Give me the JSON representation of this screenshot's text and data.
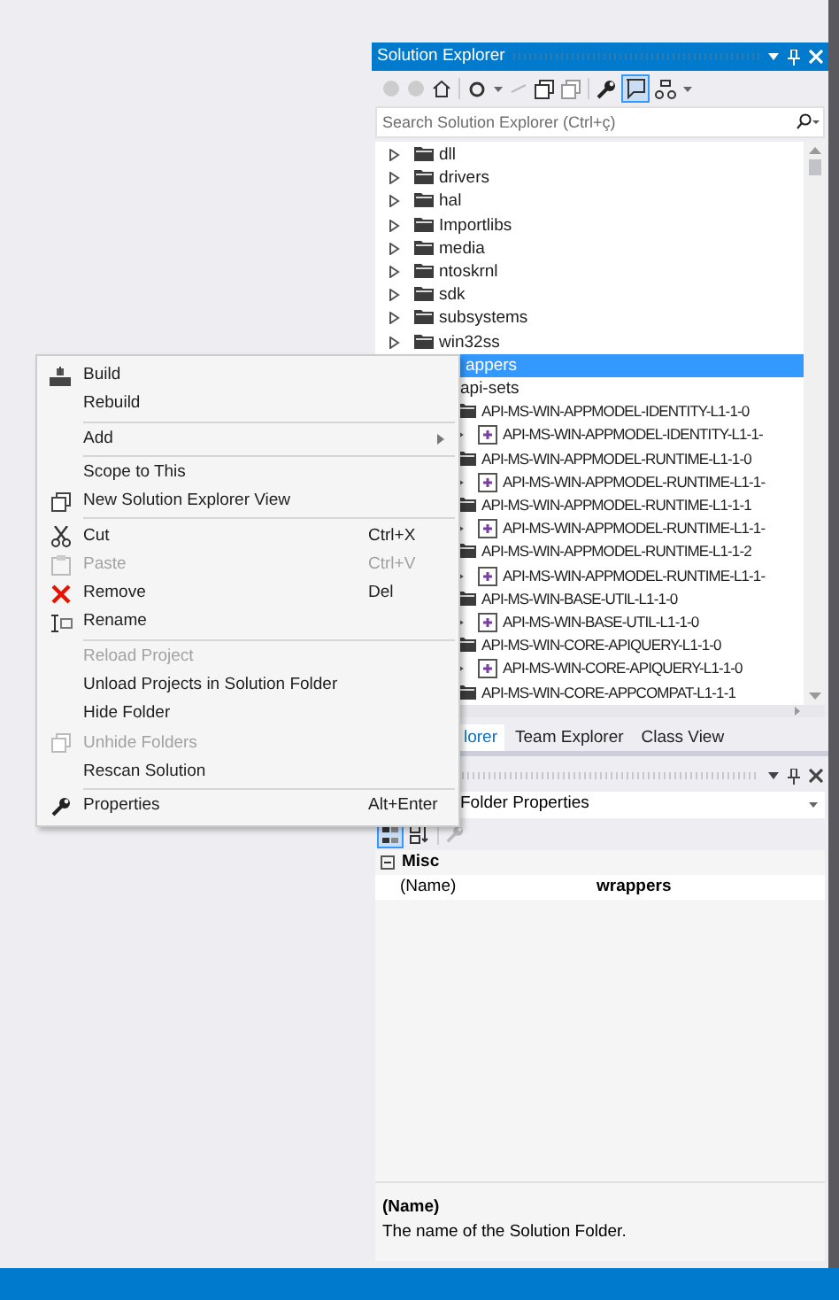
{
  "solution_explorer": {
    "title": "Solution Explorer",
    "search": {
      "placeholder": "Search Solution Explorer (Ctrl+ç)"
    },
    "tree": [
      {
        "label": "dll",
        "kind": "folder",
        "expanded": false,
        "selected": false
      },
      {
        "label": "drivers",
        "kind": "folder",
        "expanded": false,
        "selected": false
      },
      {
        "label": "hal",
        "kind": "folder",
        "expanded": false,
        "selected": false
      },
      {
        "label": "Importlibs",
        "kind": "folder",
        "expanded": false,
        "selected": false
      },
      {
        "label": "media",
        "kind": "folder",
        "expanded": false,
        "selected": false
      },
      {
        "label": "ntoskrnl",
        "kind": "folder",
        "expanded": false,
        "selected": false
      },
      {
        "label": "sdk",
        "kind": "folder",
        "expanded": false,
        "selected": false
      },
      {
        "label": "subsystems",
        "kind": "folder",
        "expanded": false,
        "selected": false
      },
      {
        "label": "win32ss",
        "kind": "folder",
        "expanded": false,
        "selected": false
      },
      {
        "label": "appers",
        "selected": true,
        "children": [
          {
            "label": "api-sets",
            "selected": false,
            "children": [
              {
                "label": "API-MS-WIN-APPMODEL-IDENTITY-L1-1-0",
                "kind": "folder",
                "selected": false,
                "children": [
                  {
                    "label": "API-MS-WIN-APPMODEL-IDENTITY-L1-1-",
                    "kind": "project",
                    "expanded": false,
                    "selected": false
                  }
                ]
              },
              {
                "label": "API-MS-WIN-APPMODEL-RUNTIME-L1-1-0",
                "kind": "folder",
                "selected": false,
                "children": [
                  {
                    "label": "API-MS-WIN-APPMODEL-RUNTIME-L1-1-",
                    "kind": "project",
                    "expanded": false,
                    "selected": false
                  }
                ]
              },
              {
                "label": "API-MS-WIN-APPMODEL-RUNTIME-L1-1-1",
                "kind": "folder",
                "selected": false,
                "children": [
                  {
                    "label": "API-MS-WIN-APPMODEL-RUNTIME-L1-1-",
                    "kind": "project",
                    "expanded": false,
                    "selected": false
                  }
                ]
              },
              {
                "label": "API-MS-WIN-APPMODEL-RUNTIME-L1-1-2",
                "kind": "folder",
                "selected": false,
                "children": [
                  {
                    "label": "API-MS-WIN-APPMODEL-RUNTIME-L1-1-",
                    "kind": "project",
                    "expanded": false,
                    "selected": false
                  }
                ]
              },
              {
                "label": "API-MS-WIN-BASE-UTIL-L1-1-0",
                "kind": "folder",
                "selected": false,
                "children": [
                  {
                    "label": "API-MS-WIN-BASE-UTIL-L1-1-0",
                    "kind": "project",
                    "expanded": false,
                    "selected": false
                  }
                ]
              },
              {
                "label": "API-MS-WIN-CORE-APIQUERY-L1-1-0",
                "kind": "folder",
                "selected": false,
                "children": [
                  {
                    "label": "API-MS-WIN-CORE-APIQUERY-L1-1-0",
                    "kind": "project",
                    "expanded": false,
                    "selected": false
                  }
                ]
              },
              {
                "label": "API-MS-WIN-CORE-APPCOMPAT-L1-1-1",
                "kind": "folder",
                "selected": false
              }
            ]
          }
        ]
      }
    ],
    "tabs": [
      {
        "label": "lorer",
        "selected": true
      },
      {
        "label": "Team Explorer",
        "selected": false
      },
      {
        "label": "Class View",
        "selected": false
      }
    ]
  },
  "properties": {
    "object": "Folder Properties",
    "category": "Misc",
    "expanded": true,
    "rows": [
      {
        "name": "(Name)",
        "value": "wrappers"
      }
    ],
    "description": {
      "title": "(Name)",
      "text": "The name of the Solution Folder."
    }
  },
  "context_menu": {
    "groups": [
      [
        {
          "label": "Build",
          "disabled": false
        },
        {
          "label": "Rebuild",
          "disabled": false
        }
      ],
      [
        {
          "label": "Add",
          "disabled": false,
          "submenu": true
        }
      ],
      [
        {
          "label": "Scope to This",
          "disabled": false
        },
        {
          "label": "New Solution Explorer View",
          "disabled": false
        }
      ],
      [
        {
          "label": "Cut",
          "shortcut": "Ctrl+X",
          "disabled": false
        },
        {
          "label": "Paste",
          "shortcut": "Ctrl+V",
          "disabled": true
        },
        {
          "label": "Remove",
          "shortcut": "Del",
          "disabled": false
        },
        {
          "label": "Rename",
          "disabled": false
        }
      ],
      [
        {
          "label": "Reload Project",
          "disabled": true
        },
        {
          "label": "Unload Projects in Solution Folder",
          "disabled": false
        },
        {
          "label": "Hide Folder",
          "disabled": false
        },
        {
          "label": "Unhide Folders",
          "disabled": true
        },
        {
          "label": "Rescan Solution",
          "disabled": false
        }
      ],
      [
        {
          "label": "Properties",
          "shortcut": "Alt+Enter",
          "disabled": false
        }
      ]
    ]
  }
}
